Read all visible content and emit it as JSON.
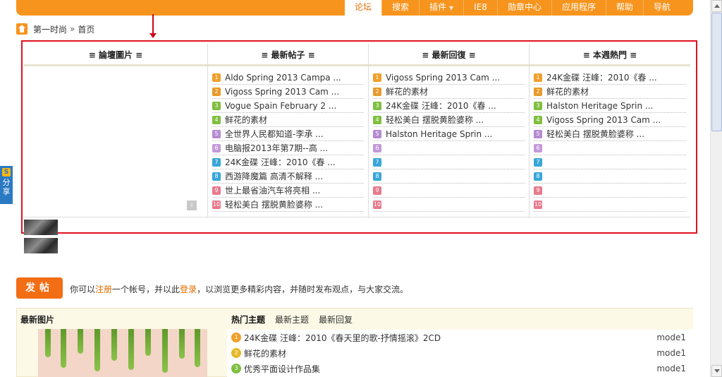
{
  "nav": {
    "items": [
      {
        "label": "论坛",
        "active": true
      },
      {
        "label": "搜索"
      },
      {
        "label": "插件",
        "caret": "▼"
      },
      {
        "label": "IE8"
      },
      {
        "label": "勋章中心"
      },
      {
        "label": "应用程序"
      },
      {
        "label": "帮助"
      },
      {
        "label": "导航"
      }
    ]
  },
  "breadcrumb": {
    "site": "第一时尚",
    "sep": "»",
    "current": "首页"
  },
  "columns": [
    {
      "title": "≡ 論壇圖片 ≡",
      "items": []
    },
    {
      "title": "≡ 最新帖子 ≡",
      "items": [
        "Aldo Spring 2013 Campa ...",
        "Vigoss Spring 2013 Cam ...",
        "Vogue Spain February 2 ...",
        "鲜花的素材",
        "全世界人民都知道-李承 ...",
        "电脑报2013年第7期--高 ...",
        "24K金碟 汪峰：2010《春 ...",
        "西游降魔篇 高清不解释 ...",
        "世上最省油汽车将亮相 ...",
        "轻松美白 摆脱黄脸婆称 ..."
      ]
    },
    {
      "title": "≡ 最新回復 ≡",
      "items": [
        "Vigoss Spring 2013 Cam ...",
        "鲜花的素材",
        "24K金碟 汪峰：2010《春 ...",
        "轻松美白 摆脱黄脸婆称 ...",
        "Halston Heritage Sprin ...",
        "",
        "",
        "",
        "",
        ""
      ]
    },
    {
      "title": "≡ 本週熱門 ≡",
      "items": [
        "24K金碟 汪峰：2010《春 ...",
        "鲜花的素材",
        "Halston Heritage Sprin ...",
        "Vigoss Spring 2013 Cam ...",
        "轻松美白 摆脱黄脸婆称 ...",
        "",
        "",
        "",
        "",
        ""
      ]
    }
  ],
  "rank_numbers": [
    "1",
    "2",
    "3",
    "4",
    "5",
    "6",
    "7",
    "8",
    "9",
    "10"
  ],
  "more_button": "i",
  "share": {
    "icon": "S",
    "label1": "分",
    "label2": "享"
  },
  "post": {
    "button": "发帖",
    "note_a": "你可以",
    "register": "注册",
    "note_b": "一个帐号，并以此",
    "login": "登录",
    "note_c": "，以浏览更多精彩内容，并随时发布观点，与大家交流。"
  },
  "bottom": {
    "left_title": "最新图片",
    "tabs": [
      "热门主题",
      "最新主题",
      "最新回复"
    ],
    "rows": [
      {
        "rank": "1",
        "title": "24K金碟 汪峰：2010《春天里的歌-抒情摇滚》2CD",
        "author": "mode1",
        "color": "#f0a02c"
      },
      {
        "rank": "2",
        "title": "鲜花的素材",
        "author": "mode1",
        "color": "#e8b82a"
      },
      {
        "rank": "3",
        "title": "优秀平面设计作品集",
        "author": "mode1",
        "color": "#7fbf3f"
      }
    ]
  }
}
